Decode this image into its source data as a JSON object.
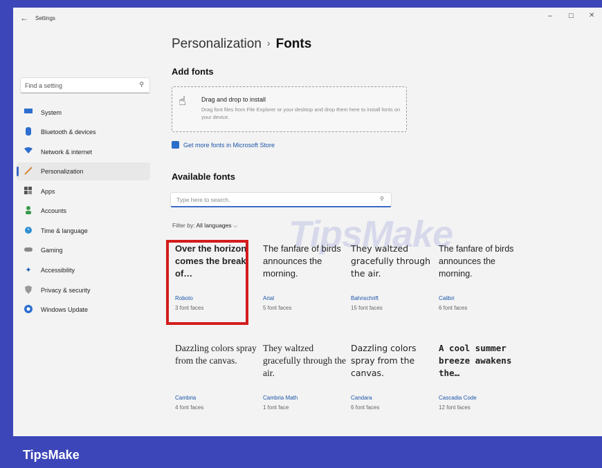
{
  "window": {
    "title": "Settings",
    "back_icon": "←",
    "minimize": "–",
    "maximize": "☐",
    "close": "✕"
  },
  "sidebar": {
    "search_placeholder": "Find a setting",
    "items": [
      {
        "label": "System",
        "icon": "monitor-icon",
        "color": "#2d6fcf"
      },
      {
        "label": "Bluetooth & devices",
        "icon": "bluetooth-icon",
        "color": "#2d6fcf"
      },
      {
        "label": "Network & internet",
        "icon": "wifi-icon",
        "color": "#2d6fcf"
      },
      {
        "label": "Personalization",
        "icon": "brush-icon",
        "color": "#d4863b",
        "active": true
      },
      {
        "label": "Apps",
        "icon": "apps-icon",
        "color": "#666"
      },
      {
        "label": "Accounts",
        "icon": "person-icon",
        "color": "#3a9a4c"
      },
      {
        "label": "Time & language",
        "icon": "globe-clock-icon",
        "color": "#2d8fcf"
      },
      {
        "label": "Gaming",
        "icon": "gamepad-icon",
        "color": "#888"
      },
      {
        "label": "Accessibility",
        "icon": "accessibility-icon",
        "color": "#1f5fb8"
      },
      {
        "label": "Privacy & security",
        "icon": "shield-icon",
        "color": "#888"
      },
      {
        "label": "Windows Update",
        "icon": "update-icon",
        "color": "#2d6fcf"
      }
    ]
  },
  "breadcrumb": {
    "parent": "Personalization",
    "separator": "›",
    "current": "Fonts"
  },
  "add_fonts": {
    "heading": "Add fonts",
    "drop_title": "Drag and drop to install",
    "drop_desc": "Drag font files from File Explorer or your desktop and drop them here to install fonts on your device.",
    "store_link": "Get more fonts in Microsoft Store"
  },
  "available": {
    "heading": "Available fonts",
    "search_placeholder": "Type here to search.",
    "filter_label": "Filter by:",
    "filter_value": "All languages",
    "fonts": [
      {
        "sample": "Over the horizon comes the break of…",
        "name": "Roboto",
        "faces": "3 font faces"
      },
      {
        "sample": "The fanfare of birds announces the morning.",
        "name": "Arial",
        "faces": "5 font faces"
      },
      {
        "sample": "They waltzed gracefully through the air.",
        "name": "Bahnschrift",
        "faces": "15 font faces"
      },
      {
        "sample": "The fanfare of birds announces the morning.",
        "name": "Calibri",
        "faces": "6 font faces"
      },
      {
        "sample": "Dazzling colors spray from the canvas.",
        "name": "Cambria",
        "faces": "4 font faces"
      },
      {
        "sample": "They waltzed gracefully through the air.",
        "name": "Cambria Math",
        "faces": "1 font face"
      },
      {
        "sample": "Dazzling colors spray from the canvas.",
        "name": "Candara",
        "faces": "6 font faces"
      },
      {
        "sample": "A cool summer breeze awakens the…",
        "name": "Cascadia Code",
        "faces": "12 font faces"
      }
    ]
  },
  "watermark": "TipsMake",
  "footer_brand": "TipsMake"
}
